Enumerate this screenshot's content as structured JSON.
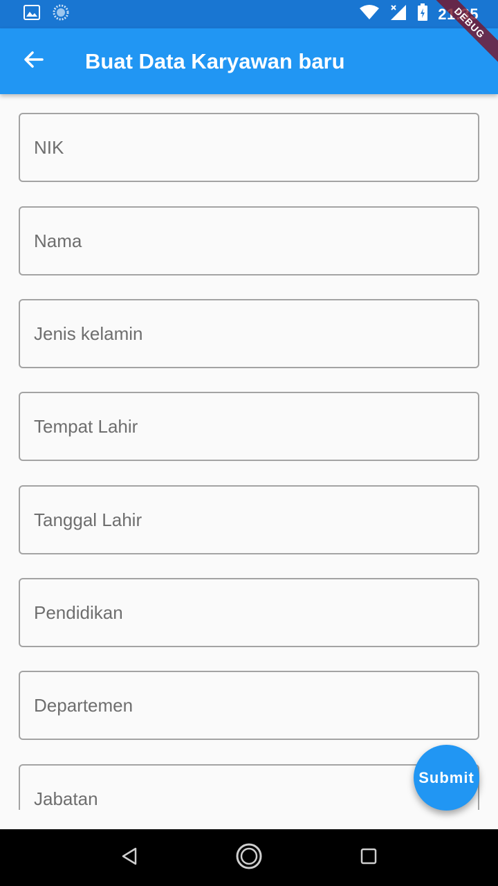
{
  "status_bar": {
    "time": "21:35",
    "icons": [
      "image-icon",
      "sync-icon",
      "wifi-icon",
      "signal-icon",
      "battery-charging-icon"
    ]
  },
  "app_bar": {
    "title": "Buat Data Karyawan baru",
    "back_icon": "arrow-back-icon",
    "background": "#2196f3"
  },
  "debug_banner": "DEBUG",
  "form": {
    "fields": [
      {
        "placeholder": "NIK",
        "value": ""
      },
      {
        "placeholder": "Nama",
        "value": ""
      },
      {
        "placeholder": "Jenis kelamin",
        "value": ""
      },
      {
        "placeholder": "Tempat Lahir",
        "value": ""
      },
      {
        "placeholder": "Tanggal Lahir",
        "value": ""
      },
      {
        "placeholder": "Pendidikan",
        "value": ""
      },
      {
        "placeholder": "Departemen",
        "value": ""
      },
      {
        "placeholder": "Jabatan",
        "value": ""
      }
    ]
  },
  "fab": {
    "label": "Submit",
    "color": "#2196f3"
  },
  "nav_bar": {
    "buttons": [
      "back-triangle-icon",
      "home-circle-icon",
      "recents-square-icon"
    ]
  }
}
